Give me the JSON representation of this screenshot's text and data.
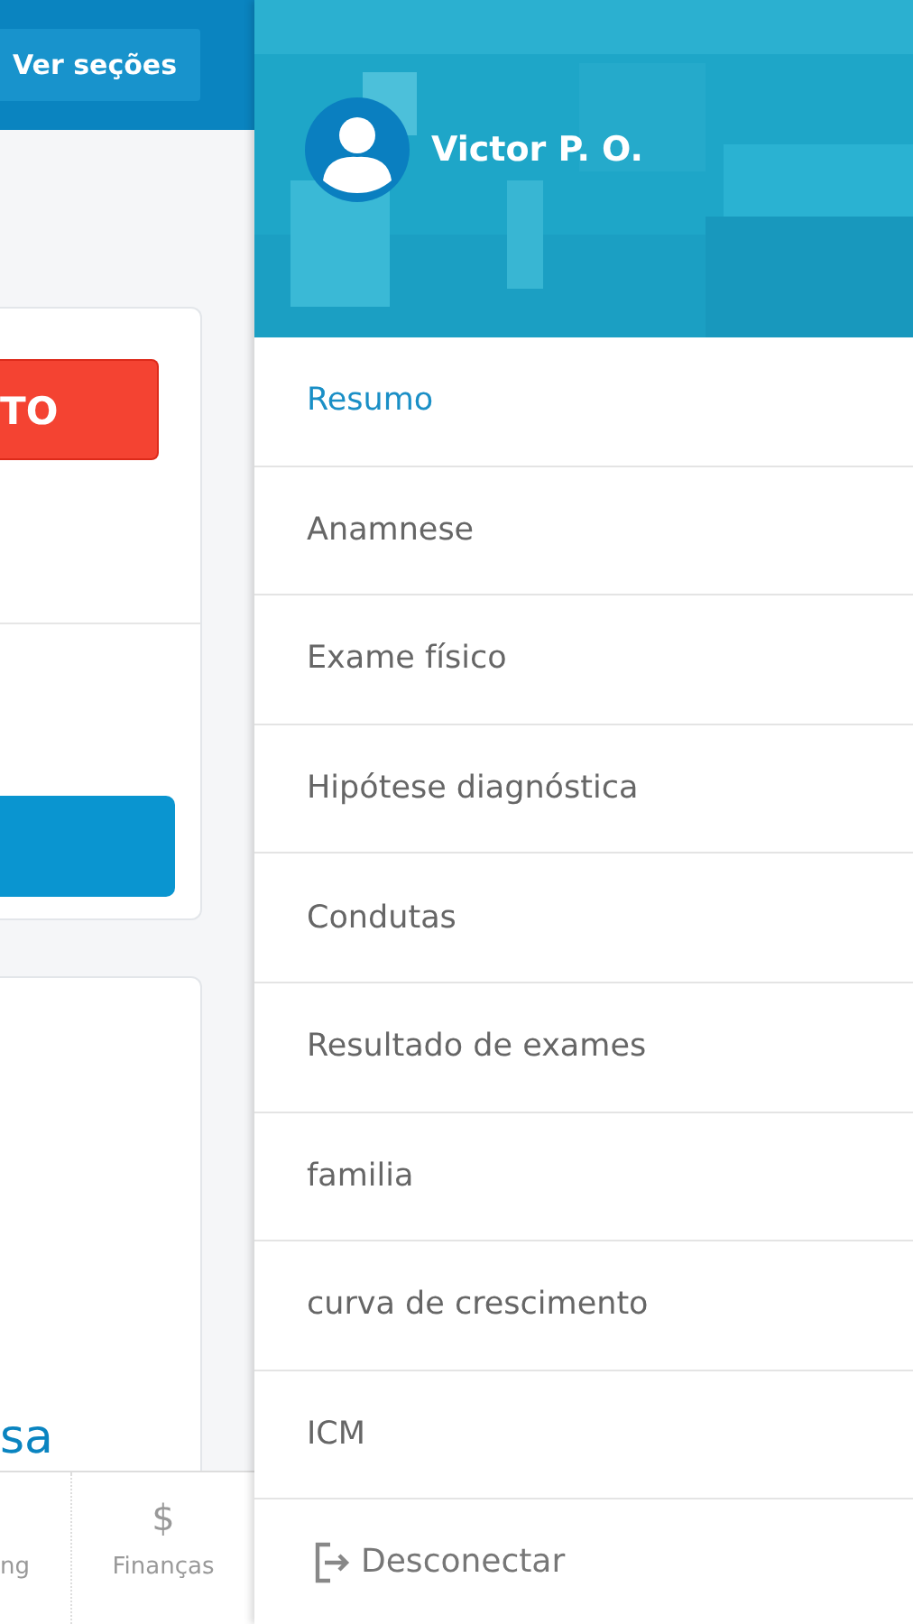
{
  "background": {
    "header_button": "Ver seções",
    "card_button": "TO",
    "highlight_text": "sa",
    "bottom_nav": [
      {
        "label": "ng",
        "kind": "text"
      },
      {
        "label": "Finanças",
        "kind": "icon",
        "icon": "$"
      }
    ]
  },
  "drawer": {
    "user": "Victor P. O.",
    "items": [
      {
        "label": "Resumo",
        "selected": true
      },
      {
        "label": "Anamnese",
        "selected": false
      },
      {
        "label": "Exame físico",
        "selected": false
      },
      {
        "label": "Hipótese diagnóstica",
        "selected": false
      },
      {
        "label": "Condutas",
        "selected": false
      },
      {
        "label": "Resultado de exames",
        "selected": false
      },
      {
        "label": "familia",
        "selected": false
      },
      {
        "label": "curva de crescimento",
        "selected": false
      },
      {
        "label": "ICM",
        "selected": false
      }
    ],
    "logout": "Desconectar"
  }
}
